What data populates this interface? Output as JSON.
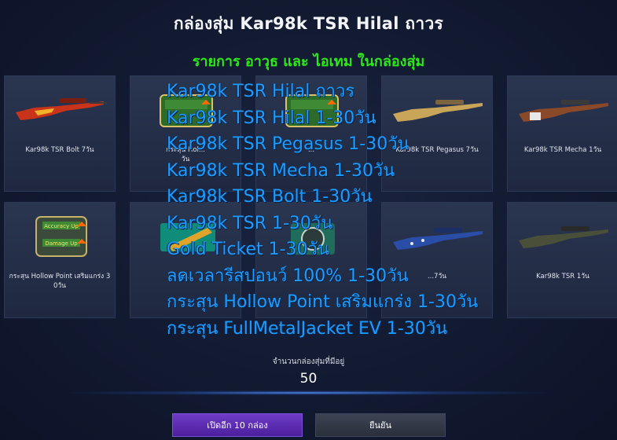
{
  "window": {
    "title": "กล่องสุ่ม Kar98k TSR Hilal ถาวร",
    "subtitle": "รายการ อาวุธ และ ไอเทม ในกล่องสุ่ม"
  },
  "tiles": [
    {
      "caption": "Kar98k TSR Bolt 7วัน",
      "icon": "rifle-orange-icon"
    },
    {
      "caption": "กระสุน Hol...",
      "caption2": "วัน",
      "icon": "accuracy-up-badge-icon"
    },
    {
      "caption": "...",
      "icon": "damage-up-badge-icon"
    },
    {
      "caption": "Kar98k TSR Pegasus 7วัน",
      "icon": "rifle-gold-icon"
    },
    {
      "caption": "Kar98k TSR Mecha 1วัน",
      "icon": "rifle-mecha-icon"
    },
    {
      "caption": "กระสุน Hollow Point เสริมแกร่ง 3",
      "caption2": "0วัน",
      "icon": "accuracy-damage-up-badge-icon"
    },
    {
      "caption": "Go...",
      "icon": "gold-ticket-icon"
    },
    {
      "caption": "...",
      "icon": "respawn-timer-icon"
    },
    {
      "caption": "...7วัน",
      "icon": "rifle-blue-icon"
    },
    {
      "caption": "Kar98k TSR 1วัน",
      "icon": "rifle-plain-icon"
    }
  ],
  "overlay_list": [
    "Kar98k TSR Hilal ถาวร",
    "Kar98k TSR Hilal 1-30วัน",
    "Kar98k TSR Pegasus 1-30วัน",
    "Kar98k TSR Mecha 1-30วัน",
    "Kar98k TSR Bolt 1-30วัน",
    "Kar98k TSR 1-30วัน",
    "Gold Ticket 1-30วัน",
    "ลดเวลารีสปอนว์ 100%  1-30วัน",
    "กระสุน Hollow Point เสริมแกร่ง 1-30วัน",
    "กระสุน FullMetalJacket EV 1-30วัน"
  ],
  "box_count": {
    "label": "จำนวนกล่องสุ่มที่มีอยู่",
    "value": "50"
  },
  "buttons": {
    "open_ten": "เปิดอีก 10 กล่อง",
    "confirm": "ยืนยัน"
  },
  "colors": {
    "subtitle": "#2ee81a",
    "overlay_text": "#1e9bff",
    "primary_button": "#5a2db3"
  }
}
